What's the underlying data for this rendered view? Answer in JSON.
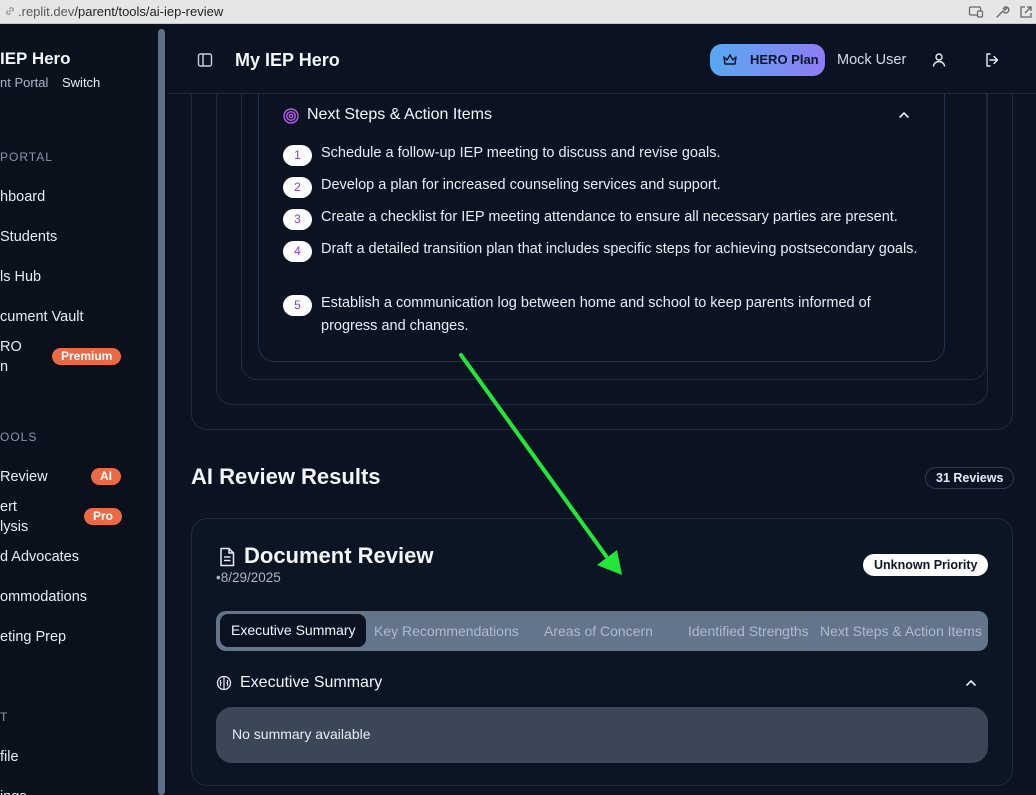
{
  "browser": {
    "url_domain": ".replit.dev",
    "url_path": "/parent/tools/ai-iep-review"
  },
  "sidebar": {
    "brand_title": "IEP Hero",
    "brand_subtitle": "nt Portal",
    "switch_label": "Switch",
    "section_portal": "PORTAL",
    "portal_items": [
      {
        "label": "hboard"
      },
      {
        "label": "Students"
      },
      {
        "label": "ls Hub"
      },
      {
        "label": "cument Vault"
      },
      {
        "label_line1": "RO",
        "label_line2": "n",
        "badge": "Premium"
      }
    ],
    "section_tools": "OOLS",
    "tool_items": [
      {
        "label": "Review",
        "badge": "AI"
      },
      {
        "label_line1": "ert",
        "label_line2": "lysis",
        "badge": "Pro"
      },
      {
        "label": "d Advocates"
      },
      {
        "label": "ommodations"
      },
      {
        "label": "eting Prep"
      }
    ],
    "section_account": "T",
    "account_items": [
      {
        "label": "file"
      },
      {
        "label": "ings"
      }
    ]
  },
  "header": {
    "title": "My IEP Hero",
    "plan_label": "HERO Plan",
    "user_name": "Mock User"
  },
  "next_steps": {
    "title": "Next Steps & Action Items",
    "items": [
      {
        "num": "1",
        "text": "Schedule a follow-up IEP meeting to discuss and revise goals."
      },
      {
        "num": "2",
        "text": "Develop a plan for increased counseling services and support."
      },
      {
        "num": "3",
        "text": "Create a checklist for IEP meeting attendance to ensure all necessary parties are present."
      },
      {
        "num": "4",
        "text": "Draft a detailed transition plan that includes specific steps for achieving postsecondary goals."
      },
      {
        "num": "5",
        "text": "Establish a communication log between home and school to keep parents informed of progress and changes."
      }
    ]
  },
  "results": {
    "title": "AI Review Results",
    "count_badge": "31 Reviews"
  },
  "review": {
    "title": "Document Review",
    "date": "•8/29/2025",
    "priority": "Unknown Priority",
    "tabs": [
      {
        "label": "Executive Summary",
        "active": true
      },
      {
        "label": "Key Recommendations"
      },
      {
        "label": "Areas of Concern"
      },
      {
        "label": "Identified Strengths"
      },
      {
        "label": "Next Steps & Action Items"
      }
    ],
    "section_title": "Executive Summary",
    "summary_text": "No summary available"
  },
  "colors": {
    "background": "#0b1322",
    "badge_orange": "#ea6a45",
    "plan_gradient_start": "#59a8f0",
    "plan_gradient_end": "#8e7cf4",
    "step_number": "#8a3ad6",
    "annotation_arrow": "#22e63a"
  }
}
